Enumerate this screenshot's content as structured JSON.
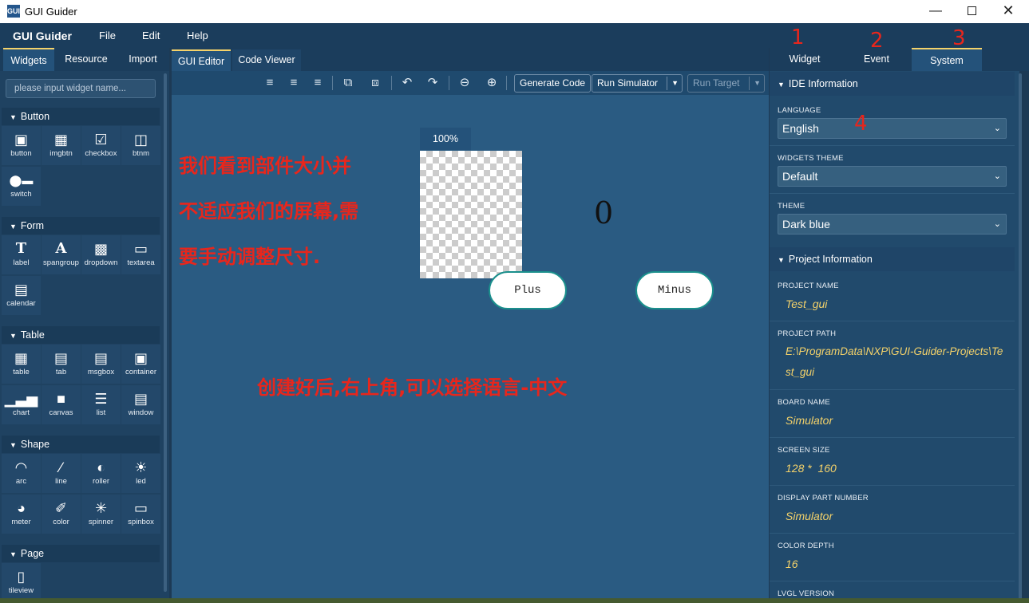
{
  "window": {
    "title": "GUI Guider",
    "app_icon_text": "GUI"
  },
  "menubar": {
    "brand": "GUI Guider",
    "items": [
      "File",
      "Edit",
      "Help"
    ]
  },
  "left_tabs": [
    "Widgets",
    "Resource",
    "Import"
  ],
  "search": {
    "placeholder": "please input widget name..."
  },
  "sections": {
    "button": {
      "title": "Button",
      "items": [
        {
          "label": "button",
          "icon": "button-icon"
        },
        {
          "label": "imgbtn",
          "icon": "imgbtn-icon"
        },
        {
          "label": "checkbox",
          "icon": "checkbox-icon"
        },
        {
          "label": "btnm",
          "icon": "btnm-icon"
        },
        {
          "label": "switch",
          "icon": "switch-icon"
        }
      ]
    },
    "form": {
      "title": "Form",
      "items": [
        {
          "label": "label",
          "icon": "label-icon"
        },
        {
          "label": "spangroup",
          "icon": "spangroup-icon"
        },
        {
          "label": "dropdown",
          "icon": "dropdown-icon"
        },
        {
          "label": "textarea",
          "icon": "textarea-icon"
        },
        {
          "label": "calendar",
          "icon": "calendar-icon"
        }
      ]
    },
    "table": {
      "title": "Table",
      "items": [
        {
          "label": "table",
          "icon": "table-icon"
        },
        {
          "label": "tab",
          "icon": "tab-icon"
        },
        {
          "label": "msgbox",
          "icon": "msgbox-icon"
        },
        {
          "label": "container",
          "icon": "container-icon"
        },
        {
          "label": "chart",
          "icon": "chart-icon"
        },
        {
          "label": "canvas",
          "icon": "canvas-icon"
        },
        {
          "label": "list",
          "icon": "list-icon"
        },
        {
          "label": "window",
          "icon": "window-icon"
        }
      ]
    },
    "shape": {
      "title": "Shape",
      "items": [
        {
          "label": "arc",
          "icon": "arc-icon"
        },
        {
          "label": "line",
          "icon": "line-icon"
        },
        {
          "label": "roller",
          "icon": "roller-icon"
        },
        {
          "label": "led",
          "icon": "led-icon"
        },
        {
          "label": "meter",
          "icon": "meter-icon"
        },
        {
          "label": "color",
          "icon": "color-icon"
        },
        {
          "label": "spinner",
          "icon": "spinner-icon"
        },
        {
          "label": "spinbox",
          "icon": "spinbox-icon"
        }
      ]
    },
    "page": {
      "title": "Page",
      "items": [
        {
          "label": "tileview",
          "icon": "tileview-icon"
        }
      ]
    }
  },
  "editor_tabs": [
    "GUI Editor",
    "Code Viewer"
  ],
  "toolbar": {
    "generate_code": "Generate Code",
    "run_simulator": "Run Simulator",
    "run_target": "Run Target"
  },
  "canvas": {
    "zoom": "100%",
    "counter": "0",
    "plus_label": "Plus",
    "minus_label": "Minus",
    "annotation_1_line1": "我们看到部件大小并",
    "annotation_1_line2": "不适应我们的屏幕,需",
    "annotation_1_line3": "要手动调整尺寸.",
    "annotation_2": "创建好后,右上角,可以选择语言-中文"
  },
  "right_tabs": [
    {
      "label": "Widget",
      "marker": "1"
    },
    {
      "label": "Event",
      "marker": "2"
    },
    {
      "label": "System",
      "marker": "3"
    }
  ],
  "ide_info": {
    "title": "IDE Information",
    "language_label": "LANGUAGE",
    "language_value": "English",
    "language_marker": "4",
    "widgets_theme_label": "WIDGETS THEME",
    "widgets_theme_value": "Default",
    "theme_label": "THEME",
    "theme_value": "Dark blue"
  },
  "project_info": {
    "title": "Project Information",
    "project_name_label": "PROJECT NAME",
    "project_name": "Test_gui",
    "project_path_label": "PROJECT PATH",
    "project_path_line1": "E:\\ProgramData\\NXP\\GUI-Guider-Projects\\Te",
    "project_path_line2": "st_gui",
    "board_name_label": "BOARD NAME",
    "board_name": "Simulator",
    "screen_size_label": "SCREEN SIZE",
    "screen_size": "128 *  160",
    "display_part_label": "DISPLAY PART NUMBER",
    "display_part": "Simulator",
    "color_depth_label": "COLOR DEPTH",
    "color_depth": "16",
    "lvgl_version_label": "LVGL VERSION"
  },
  "colors": {
    "accent": "#2d6ea8",
    "annotation": "#e8261c",
    "value": "#f4d26a",
    "tab_active": "#f4d26a"
  }
}
